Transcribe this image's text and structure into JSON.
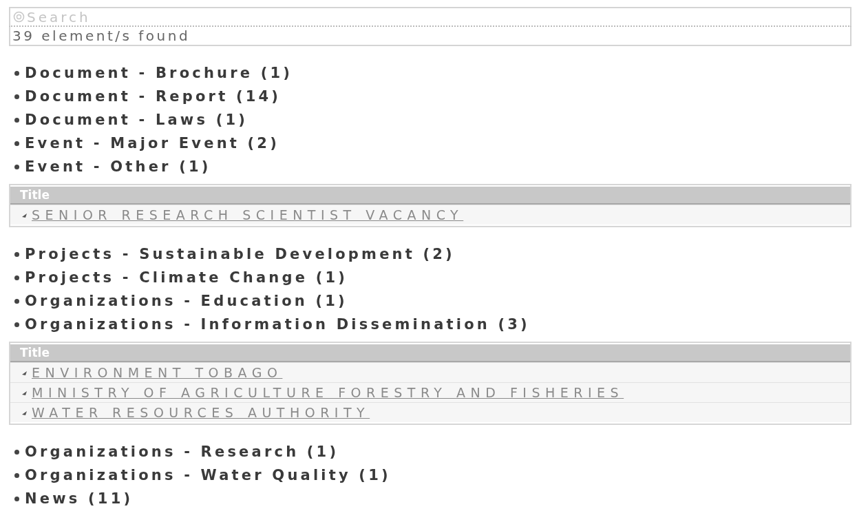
{
  "search": {
    "placeholder": "Search",
    "result_count": "39 element/s found"
  },
  "sections": [
    {
      "kind": "category",
      "label": "Document - Brochure (1)"
    },
    {
      "kind": "category",
      "label": "Document - Report (14)"
    },
    {
      "kind": "category",
      "label": "Document - Laws (1)"
    },
    {
      "kind": "category",
      "label": "Event - Major Event (2)"
    },
    {
      "kind": "category",
      "label": "Event - Other (1)"
    },
    {
      "kind": "table",
      "header": "Title",
      "rows": [
        "SENIOR RESEARCH SCIENTIST VACANCY"
      ]
    },
    {
      "kind": "category",
      "label": "Projects - Sustainable Development (2)"
    },
    {
      "kind": "category",
      "label": "Projects - Climate Change (1)"
    },
    {
      "kind": "category",
      "label": "Organizations - Education (1)"
    },
    {
      "kind": "category",
      "label": "Organizations - Information Dissemination (3)"
    },
    {
      "kind": "table",
      "header": "Title",
      "rows": [
        "ENVIRONMENT TOBAGO",
        "MINISTRY OF AGRICULTURE FORESTRY AND FISHERIES",
        "WATER RESOURCES AUTHORITY"
      ]
    },
    {
      "kind": "category",
      "label": "Organizations - Research (1)"
    },
    {
      "kind": "category",
      "label": "Organizations - Water Quality (1)"
    },
    {
      "kind": "category",
      "label": "News (11)"
    }
  ]
}
